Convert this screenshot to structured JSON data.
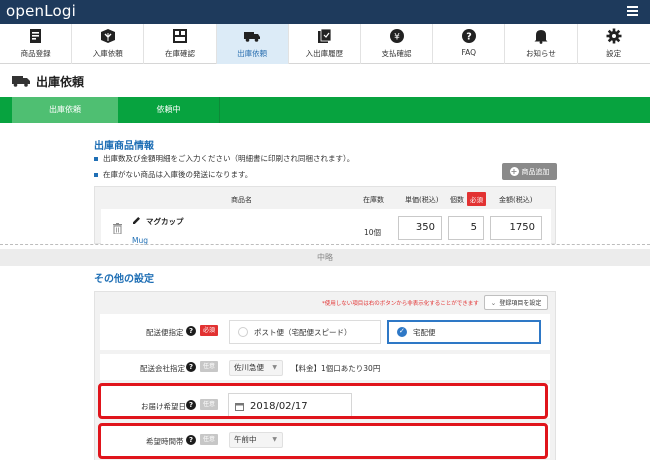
{
  "topbar": {
    "logo": "openLogi",
    "menu_icon": "list-icon"
  },
  "nav": [
    {
      "label": "商品登録",
      "icon": "product-register-icon"
    },
    {
      "label": "入庫依頼",
      "icon": "inbound-box-icon"
    },
    {
      "label": "在庫確認",
      "icon": "shelf-icon"
    },
    {
      "label": "出庫依頼",
      "icon": "truck-icon",
      "active": true
    },
    {
      "label": "入出庫履歴",
      "icon": "history-icon"
    },
    {
      "label": "支払確認",
      "icon": "yen-coin-icon"
    },
    {
      "label": "FAQ",
      "icon": "help-icon"
    },
    {
      "label": "お知らせ",
      "icon": "bell-icon"
    },
    {
      "label": "設定",
      "icon": "gear-icon"
    }
  ],
  "page": {
    "title": "出庫依頼"
  },
  "steps": {
    "step1": "出庫依頼",
    "step2": "依頼中"
  },
  "products_section": {
    "title": "出庫商品情報",
    "bullets": [
      "出庫数及び金額明細をご入力ください（明細書に印刷され同梱されます）。",
      "在庫がない商品は入庫後の発送になります。"
    ],
    "add_button": "商品追加",
    "columns": {
      "name": "商品名",
      "stock": "在庫数",
      "unit_price": "単価(税込)",
      "qty": "個数",
      "required": "必須",
      "amount": "金額(税込)"
    },
    "row": {
      "name": "マグカップ",
      "name_en": "Mug",
      "stock": "10個",
      "unit_price": "350",
      "qty": "5",
      "amount": "1750"
    }
  },
  "omit_label": "中略",
  "other_section": {
    "title": "その他の設定",
    "note": "*使用しない項目は右のボタンから非表示化することができます",
    "settings_button": "登録項目を設定",
    "required_tag": "必須",
    "optional_tag": "任意",
    "delivery_method": {
      "label": "配送便指定",
      "options": [
        "ポスト便（宅配便スピード）",
        "宅配便"
      ],
      "selected": "宅配便"
    },
    "carrier": {
      "label": "配送会社指定",
      "value": "佐川急便",
      "fee": "【料金】1個口あたり30円"
    },
    "delivery_date": {
      "label": "お届け希望日",
      "value": "2018/02/17"
    },
    "delivery_time": {
      "label": "希望時間帯",
      "value": "午前中"
    }
  },
  "colors": {
    "topbar": "#1e3a5c",
    "step_green": "#07a33f",
    "highlight_red": "#e0141b",
    "accent_blue": "#1f6fb5"
  }
}
